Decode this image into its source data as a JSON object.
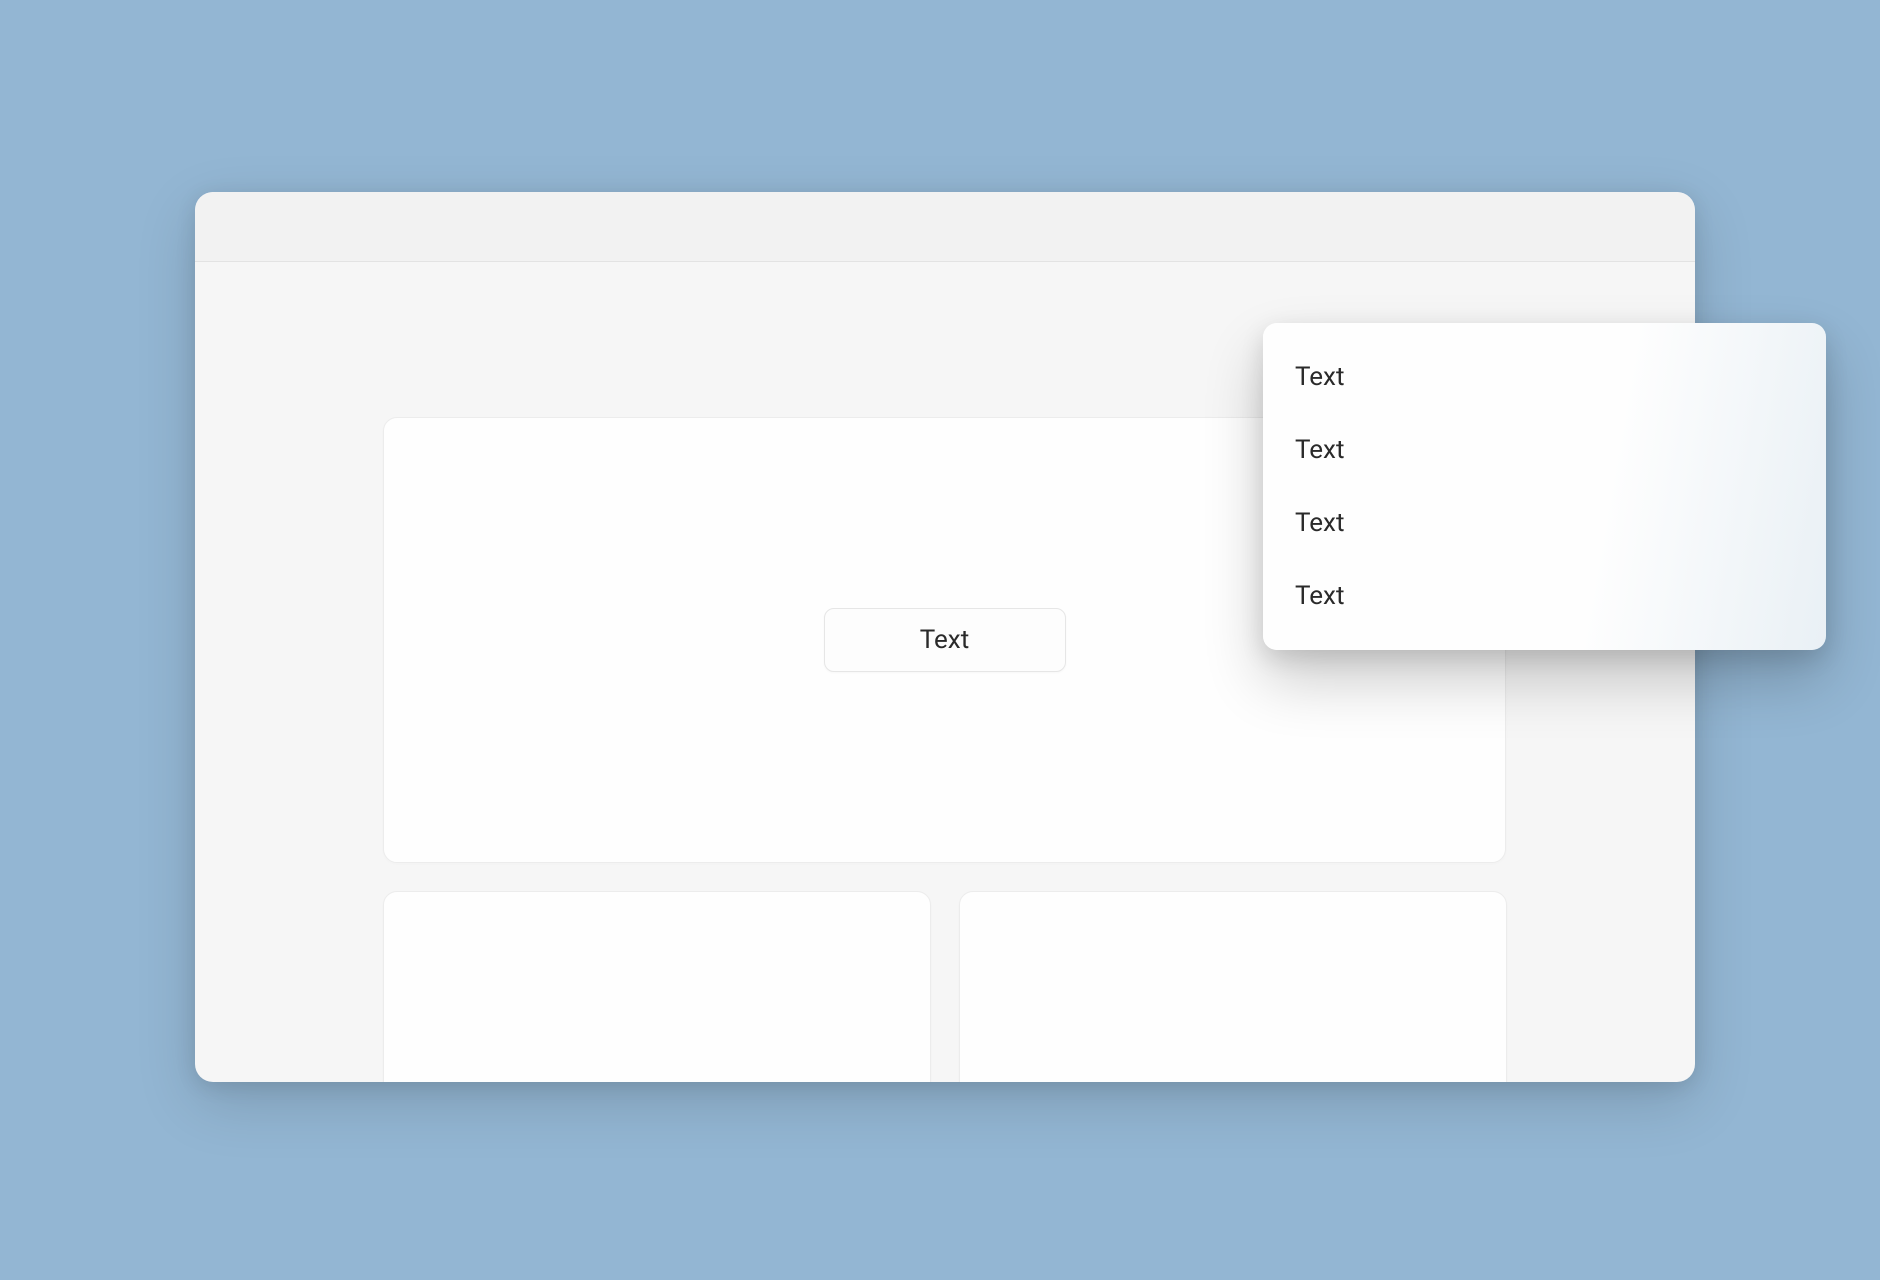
{
  "main": {
    "button_label": "Text"
  },
  "menu": {
    "items": [
      {
        "label": "Text"
      },
      {
        "label": "Text"
      },
      {
        "label": "Text"
      },
      {
        "label": "Text"
      }
    ]
  }
}
